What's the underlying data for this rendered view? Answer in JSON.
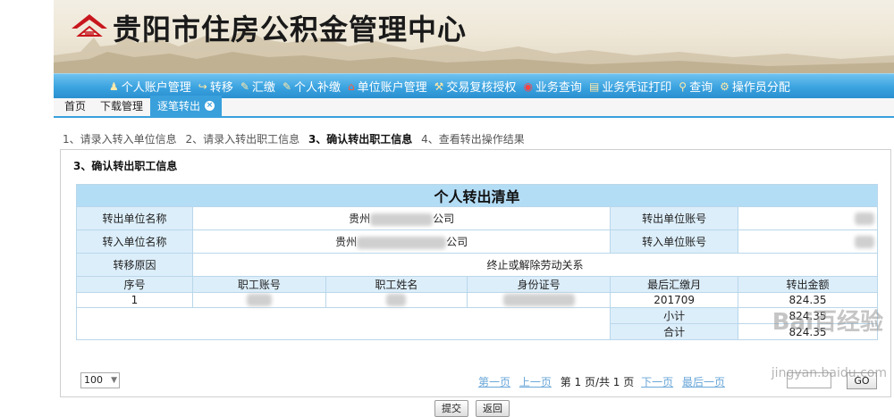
{
  "header": {
    "title": "贵阳市住房公积金管理中心"
  },
  "nav": [
    {
      "label": "个人账户管理",
      "icon": "people-icon"
    },
    {
      "label": "转移",
      "icon": "transfer-icon"
    },
    {
      "label": "汇缴",
      "icon": "pen-icon"
    },
    {
      "label": "个人补缴",
      "icon": "pen-icon"
    },
    {
      "label": "单位账户管理",
      "icon": "home-icon"
    },
    {
      "label": "交易复核授权",
      "icon": "tools-icon"
    },
    {
      "label": "业务查询",
      "icon": "query-icon"
    },
    {
      "label": "业务凭证打印",
      "icon": "document-icon"
    },
    {
      "label": "查询",
      "icon": "search-icon"
    },
    {
      "label": "操作员分配",
      "icon": "gear-icon"
    }
  ],
  "tabs": [
    {
      "label": "首页"
    },
    {
      "label": "下载管理"
    },
    {
      "label": "逐笔转出",
      "active": true
    }
  ],
  "steps": [
    "1、请录入转入单位信息",
    "2、请录入转出职工信息",
    "3、确认转出职工信息",
    "4、查看转出操作结果"
  ],
  "panel_title": "3、确认转出职工信息",
  "sheet": {
    "title": "个人转出清单",
    "out_unit_name_label": "转出单位名称",
    "out_unit_name_prefix": "贵州",
    "out_unit_name_suffix": "公司",
    "out_unit_account_label": "转出单位账号",
    "in_unit_name_label": "转入单位名称",
    "in_unit_name_prefix": "贵州",
    "in_unit_name_suffix": "公司",
    "in_unit_account_label": "转入单位账号",
    "reason_label": "转移原因",
    "reason_value": "终止或解除劳动关系",
    "columns": [
      "序号",
      "职工账号",
      "职工姓名",
      "身份证号",
      "最后汇缴月",
      "转出金额"
    ],
    "rows": [
      {
        "index": "1",
        "last_month": "201709",
        "amount": "824.35"
      }
    ],
    "subtotal_label": "小计",
    "subtotal_value": "824.35",
    "total_label": "合计",
    "total_value": "824.35"
  },
  "pager": {
    "page_size": "100",
    "first": "第一页",
    "prev": "上一页",
    "page_info": "第 1 页/共 1 页",
    "next": "下一页",
    "last": "最后一页",
    "go": "GO"
  },
  "buttons": {
    "submit": "提交",
    "back": "返回"
  },
  "watermark": {
    "line1": "Bai百经验",
    "line2": "jingyan.baidu.com"
  }
}
